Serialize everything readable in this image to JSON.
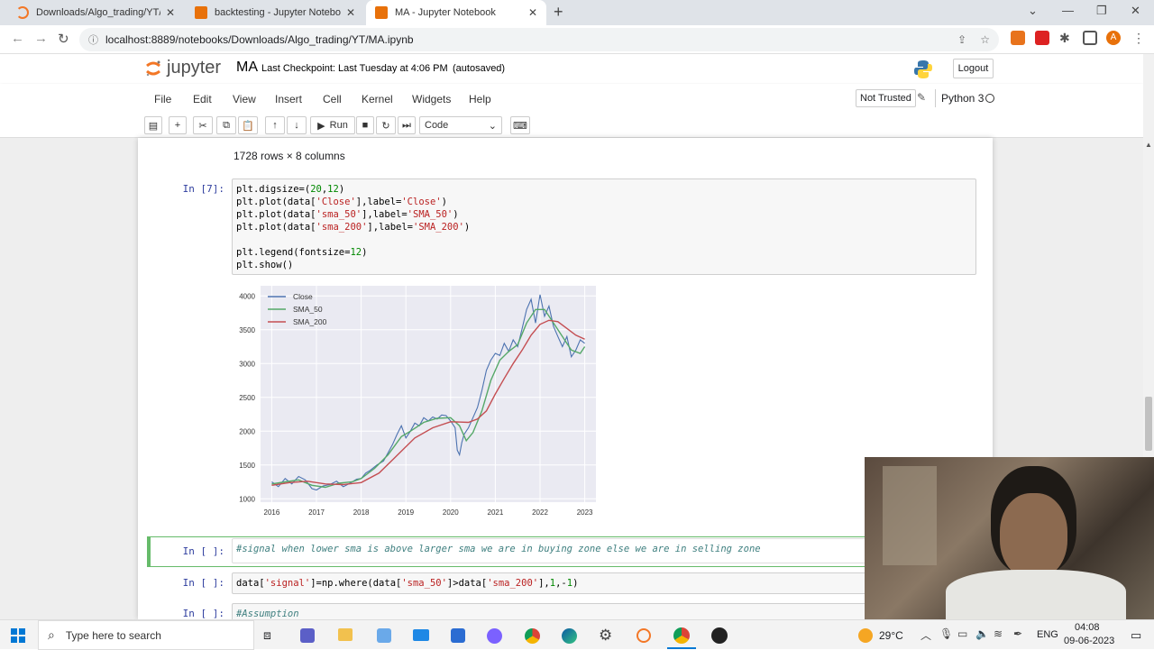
{
  "browser": {
    "tabs": [
      {
        "label": "Downloads/Algo_trading/YT/",
        "active": false
      },
      {
        "label": "backtesting - Jupyter Notebook",
        "active": false
      },
      {
        "label": "MA - Jupyter Notebook",
        "active": true
      }
    ],
    "url": "localhost:8889/notebooks/Downloads/Algo_trading/YT/MA.ipynb",
    "profile_initial": "A"
  },
  "jupyter": {
    "logo_text": "jupyter",
    "notebook_name": "MA",
    "checkpoint": "Last Checkpoint: Last Tuesday at 4:06 PM",
    "autosave": "(autosaved)",
    "logout": "Logout",
    "menu": [
      "File",
      "Edit",
      "View",
      "Insert",
      "Cell",
      "Kernel",
      "Widgets",
      "Help"
    ],
    "trust": "Not Trusted",
    "kernel": "Python 3",
    "run_label": "Run",
    "cell_type": "Code"
  },
  "notebook": {
    "output_summary": "1728 rows × 8 columns",
    "cell7": {
      "prompt": "In [7]:",
      "lines": [
        [
          [
            "plt.digsize=(",
            ""
          ],
          [
            "20",
            "num"
          ],
          [
            ",",
            ""
          ],
          [
            "12",
            "num"
          ],
          [
            ")",
            ""
          ]
        ],
        [
          [
            "plt.plot(data[",
            ""
          ],
          [
            "'Close'",
            "str"
          ],
          [
            "],label=",
            ""
          ],
          [
            "'Close'",
            "str"
          ],
          [
            ")",
            ""
          ]
        ],
        [
          [
            "plt.plot(data[",
            ""
          ],
          [
            "'sma_50'",
            "str"
          ],
          [
            "],label=",
            ""
          ],
          [
            "'SMA_50'",
            "str"
          ],
          [
            ")",
            ""
          ]
        ],
        [
          [
            "plt.plot(data[",
            ""
          ],
          [
            "'sma_200'",
            "str"
          ],
          [
            "],label=",
            ""
          ],
          [
            "'SMA_200'",
            "str"
          ],
          [
            ")",
            ""
          ]
        ],
        [
          [
            "",
            ""
          ]
        ],
        [
          [
            "plt.legend(fontsize=",
            ""
          ],
          [
            "12",
            "num"
          ],
          [
            ")",
            ""
          ]
        ],
        [
          [
            "plt.show()",
            ""
          ]
        ]
      ]
    },
    "cell8": {
      "prompt": "In [ ]:",
      "text": "#signal when lower sma is above larger sma we are in buying zone else we are in selling zone"
    },
    "cell9": {
      "prompt": "In [ ]:",
      "lines": [
        [
          [
            "data[",
            ""
          ],
          [
            "'signal'",
            "str"
          ],
          [
            "]=np.where(data[",
            ""
          ],
          [
            "'sma_50'",
            "str"
          ],
          [
            "]>data[",
            ""
          ],
          [
            "'sma_200'",
            "str"
          ],
          [
            "],",
            ""
          ],
          [
            "1",
            "num"
          ],
          [
            ",-",
            ""
          ],
          [
            "1",
            "num"
          ],
          [
            ")",
            ""
          ]
        ]
      ]
    },
    "cell10": {
      "prompt": "In [ ]:",
      "text": "#Assumption"
    }
  },
  "chart_data": {
    "type": "line",
    "title": "",
    "xlabel": "",
    "ylabel": "",
    "xlim": [
      2015.75,
      2023.25
    ],
    "ylim": [
      950,
      4150
    ],
    "x_ticks": [
      2016,
      2017,
      2018,
      2019,
      2020,
      2021,
      2022,
      2023
    ],
    "y_ticks": [
      1000,
      1500,
      2000,
      2500,
      3000,
      3500,
      4000
    ],
    "grid": true,
    "legend": "top-left",
    "series": [
      {
        "name": "Close",
        "color": "#4c72b0",
        "x": [
          2016.0,
          2016.15,
          2016.3,
          2016.45,
          2016.6,
          2016.75,
          2016.9,
          2017.0,
          2017.15,
          2017.3,
          2017.45,
          2017.6,
          2017.75,
          2017.9,
          2018.0,
          2018.1,
          2018.2,
          2018.35,
          2018.5,
          2018.6,
          2018.7,
          2018.8,
          2018.9,
          2019.0,
          2019.1,
          2019.2,
          2019.3,
          2019.4,
          2019.5,
          2019.6,
          2019.7,
          2019.8,
          2019.9,
          2020.0,
          2020.1,
          2020.15,
          2020.2,
          2020.25,
          2020.3,
          2020.4,
          2020.5,
          2020.6,
          2020.7,
          2020.8,
          2020.9,
          2021.0,
          2021.1,
          2021.2,
          2021.3,
          2021.4,
          2021.5,
          2021.6,
          2021.7,
          2021.8,
          2021.9,
          2022.0,
          2022.1,
          2022.2,
          2022.3,
          2022.4,
          2022.5,
          2022.6,
          2022.7,
          2022.8,
          2022.9,
          2023.0
        ],
        "y": [
          1250,
          1180,
          1300,
          1220,
          1330,
          1280,
          1150,
          1130,
          1190,
          1210,
          1260,
          1180,
          1230,
          1290,
          1300,
          1380,
          1420,
          1500,
          1560,
          1680,
          1800,
          1950,
          2080,
          1900,
          2000,
          2120,
          2080,
          2200,
          2150,
          2210,
          2180,
          2240,
          2230,
          2150,
          2050,
          1720,
          1650,
          1830,
          1950,
          2050,
          2200,
          2350,
          2600,
          2900,
          3050,
          3150,
          3120,
          3300,
          3180,
          3350,
          3250,
          3520,
          3800,
          3950,
          3600,
          4020,
          3700,
          3850,
          3550,
          3400,
          3250,
          3400,
          3100,
          3200,
          3350,
          3300
        ]
      },
      {
        "name": "SMA_50",
        "color": "#55a868",
        "x": [
          2016.0,
          2016.3,
          2016.6,
          2016.9,
          2017.2,
          2017.5,
          2017.8,
          2018.0,
          2018.3,
          2018.6,
          2018.9,
          2019.1,
          2019.4,
          2019.7,
          2020.0,
          2020.2,
          2020.35,
          2020.5,
          2020.7,
          2020.9,
          2021.1,
          2021.3,
          2021.5,
          2021.7,
          2021.9,
          2022.1,
          2022.3,
          2022.5,
          2022.7,
          2022.9,
          2023.0
        ],
        "y": [
          1220,
          1250,
          1280,
          1200,
          1170,
          1230,
          1250,
          1300,
          1450,
          1650,
          1920,
          2000,
          2130,
          2190,
          2200,
          2080,
          1860,
          1980,
          2300,
          2750,
          3050,
          3180,
          3280,
          3600,
          3800,
          3800,
          3600,
          3400,
          3200,
          3150,
          3250
        ]
      },
      {
        "name": "SMA_200",
        "color": "#c44e52",
        "x": [
          2016.0,
          2016.4,
          2016.8,
          2017.2,
          2017.6,
          2018.0,
          2018.4,
          2018.8,
          2019.2,
          2019.6,
          2020.0,
          2020.4,
          2020.6,
          2020.8,
          2021.0,
          2021.2,
          2021.4,
          2021.6,
          2021.8,
          2022.0,
          2022.2,
          2022.4,
          2022.6,
          2022.8,
          2023.0
        ],
        "y": [
          1200,
          1240,
          1260,
          1220,
          1210,
          1240,
          1380,
          1640,
          1900,
          2050,
          2140,
          2130,
          2180,
          2300,
          2550,
          2780,
          3000,
          3200,
          3420,
          3580,
          3640,
          3620,
          3520,
          3420,
          3360
        ]
      }
    ]
  },
  "taskbar": {
    "search_placeholder": "Type here to search",
    "weather": "29°C",
    "lang": "ENG",
    "time": "04:08",
    "date": "09-06-2023"
  }
}
